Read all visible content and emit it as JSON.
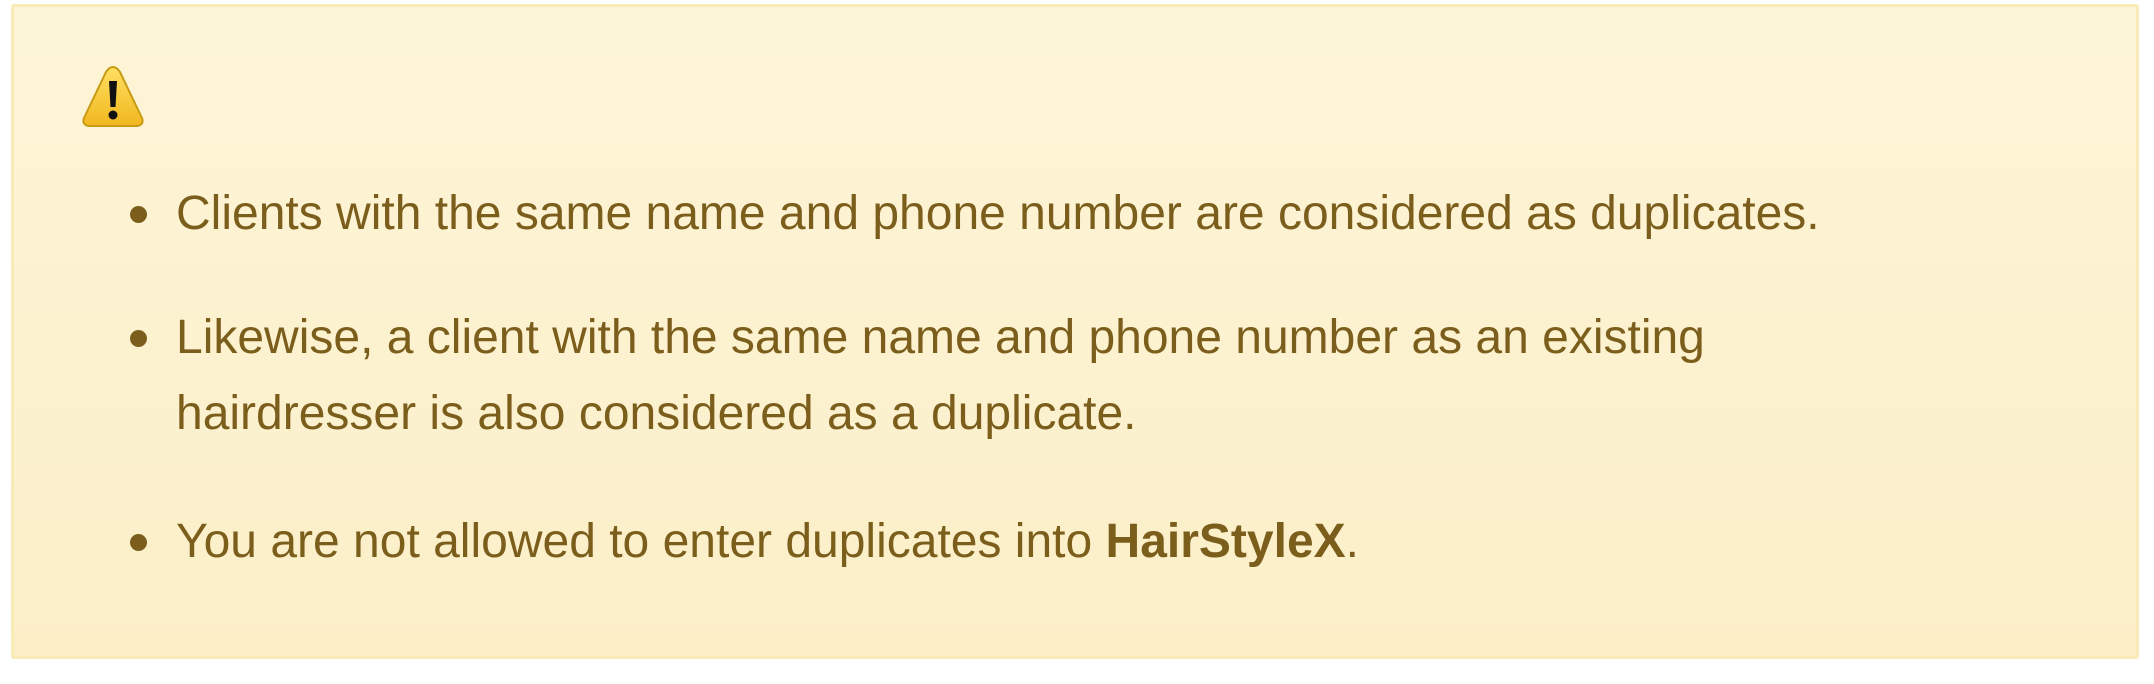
{
  "alert": {
    "icon": "warning-icon",
    "colors": {
      "background": "#fdf5d8",
      "border": "#f8ebb8",
      "text": "#7c5e1c",
      "icon": "#f4c430"
    },
    "items": [
      {
        "text": "Clients with the same name and phone number are considered as duplicates."
      },
      {
        "text": "Likewise, a client with the same name and phone number as an existing hairdresser is also considered as a duplicate."
      },
      {
        "text_before": "You are not allowed to enter duplicates into ",
        "brand": "HairStyleX",
        "text_after": "."
      }
    ]
  }
}
